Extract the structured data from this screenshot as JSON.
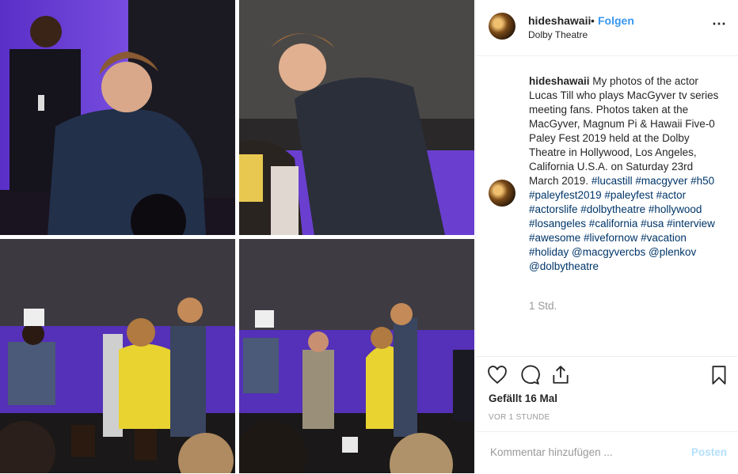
{
  "post": {
    "username": "hideshawaii",
    "separator": "•",
    "follow_label": "Folgen",
    "location": "Dolby Theatre",
    "more_icon": "⋯"
  },
  "caption": {
    "username": "hideshawaii",
    "text": "My photos of the actor Lucas Till who plays MacGyver tv series meeting fans. Photos taken at the MacGyver, Magnum Pi & Hawaii Five-0 Paley Fest 2019 held at the Dolby Theatre in Hollywood, Los Angeles, California U.S.A. on Saturday 23rd March 2019.",
    "tags": "#lucastill #macgyver #h50 #paleyfest2019 #paleyfest #actor #actorslife #dolbytheatre #hollywood #losangeles #california #usa #interview #awesome #livefornow #vacation #holiday @macgyvercbs @plenkov @dolbytheatre",
    "time": "1 Std."
  },
  "actions": {
    "icons": [
      "heart-icon",
      "comment-icon",
      "share-icon",
      "bookmark-icon"
    ],
    "likes": "Gefällt 16 Mal",
    "ago": "VOR 1 STUNDE"
  },
  "comment_box": {
    "placeholder": "Kommentar hinzufügen ...",
    "post_label": "Posten"
  },
  "colors": {
    "accent": "#3897f0",
    "stage_purple": "#6a3fd0",
    "hashtag": "#003569"
  }
}
